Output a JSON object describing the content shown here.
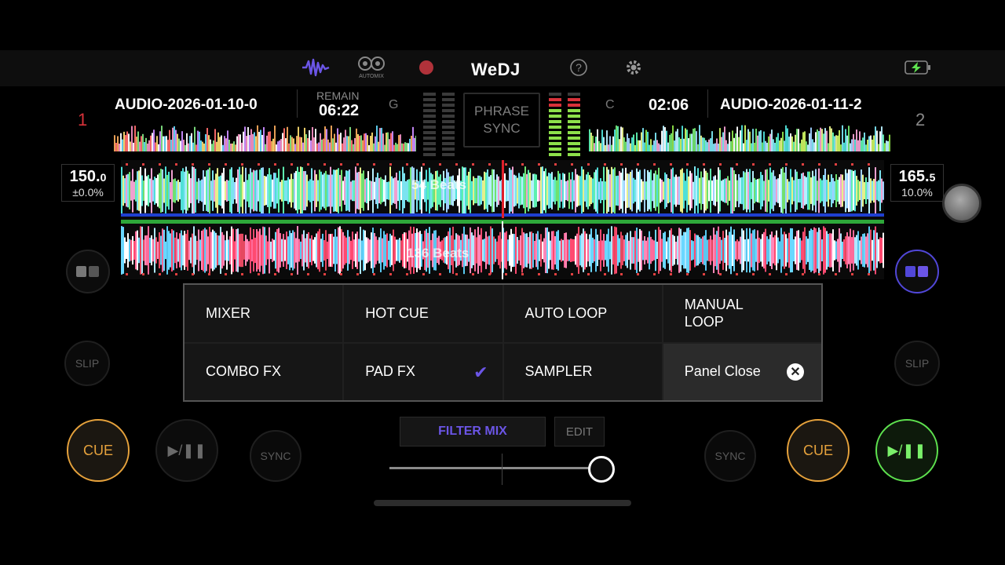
{
  "topbar": {
    "logo": "WeDJ",
    "automix_label": "AUTOMIX",
    "colors": {
      "accent": "#6b55e6",
      "record": "#b0323a",
      "battery": "#5ee24f"
    },
    "icons": [
      "waveform-icon",
      "automix-icon",
      "record-icon",
      "help-icon",
      "gear-icon",
      "battery-charging-icon"
    ]
  },
  "deck1": {
    "number": "1",
    "title": "AUDIO-2026-01-10-0",
    "remain_label": "REMAIN",
    "time": "06:22",
    "key": "G",
    "bpm": "150.",
    "bpm_decimal": "0",
    "pitch": "±0.0%",
    "beats": "54 Beats",
    "cue": "CUE",
    "play": "▶/❚❚",
    "sync": "SYNC",
    "slip": "SLIP",
    "number_color": "#d8323a",
    "play_progress": 0.47
  },
  "deck2": {
    "number": "2",
    "title": "AUDIO-2026-01-11-2",
    "time": "02:06",
    "key": "C",
    "bpm": "165.",
    "bpm_decimal": "5",
    "pitch": "10.0%",
    "beats": "136 Beats",
    "cue": "CUE",
    "play": "▶/❚❚",
    "sync": "SYNC",
    "slip": "SLIP",
    "play_progress": 0.31
  },
  "center": {
    "phrase_sync_line1": "PHRASE",
    "phrase_sync_line2": "SYNC"
  },
  "panel": {
    "buttons": [
      {
        "label": "MIXER"
      },
      {
        "label": "HOT CUE"
      },
      {
        "label": "AUTO LOOP"
      },
      {
        "label": "MANUAL LOOP",
        "line1": "MANUAL",
        "line2": "LOOP"
      },
      {
        "label": "COMBO FX"
      },
      {
        "label": "PAD FX",
        "checked": true
      },
      {
        "label": "SAMPLER"
      },
      {
        "label": "Panel Close"
      }
    ]
  },
  "filter": {
    "label": "FILTER MIX",
    "edit_label": "EDIT",
    "value": 0.95
  }
}
